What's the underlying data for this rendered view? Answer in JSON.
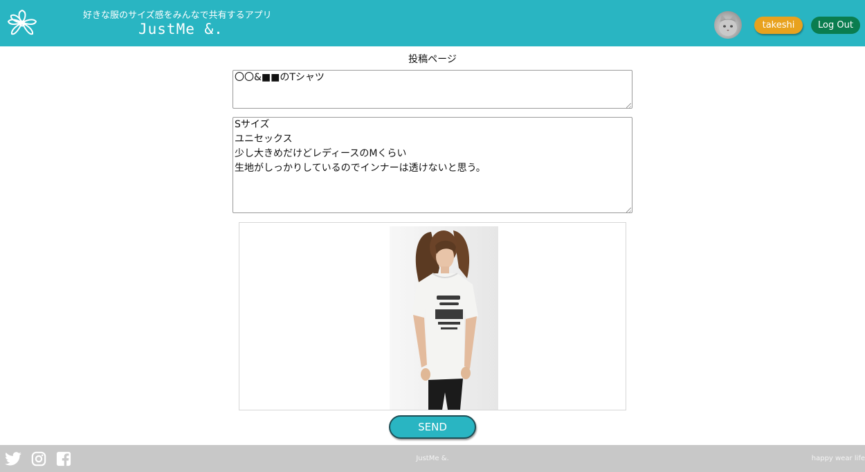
{
  "header": {
    "tagline": "好きな服のサイズ感をみんなで共有するアプリ",
    "brand": "JustMe &.",
    "user_label": "takeshi",
    "logout_label": "Log Out",
    "color": "#29b5c2",
    "logo_icon": "flower-icon"
  },
  "main": {
    "page_title": "投稿ページ",
    "title_value": "〇〇&■■のTシャツ",
    "body_value": "Sサイズ\nユニセックス\n少し大きめだけどレディースのMくらい\n生地がしっかりしているのでインナーは透けないと思う。",
    "send_label": "SEND"
  },
  "footer": {
    "brand": "JustMe &.",
    "slogan": "happy wear life",
    "social_icons": [
      "twitter-icon",
      "instagram-icon",
      "facebook-icon"
    ]
  }
}
